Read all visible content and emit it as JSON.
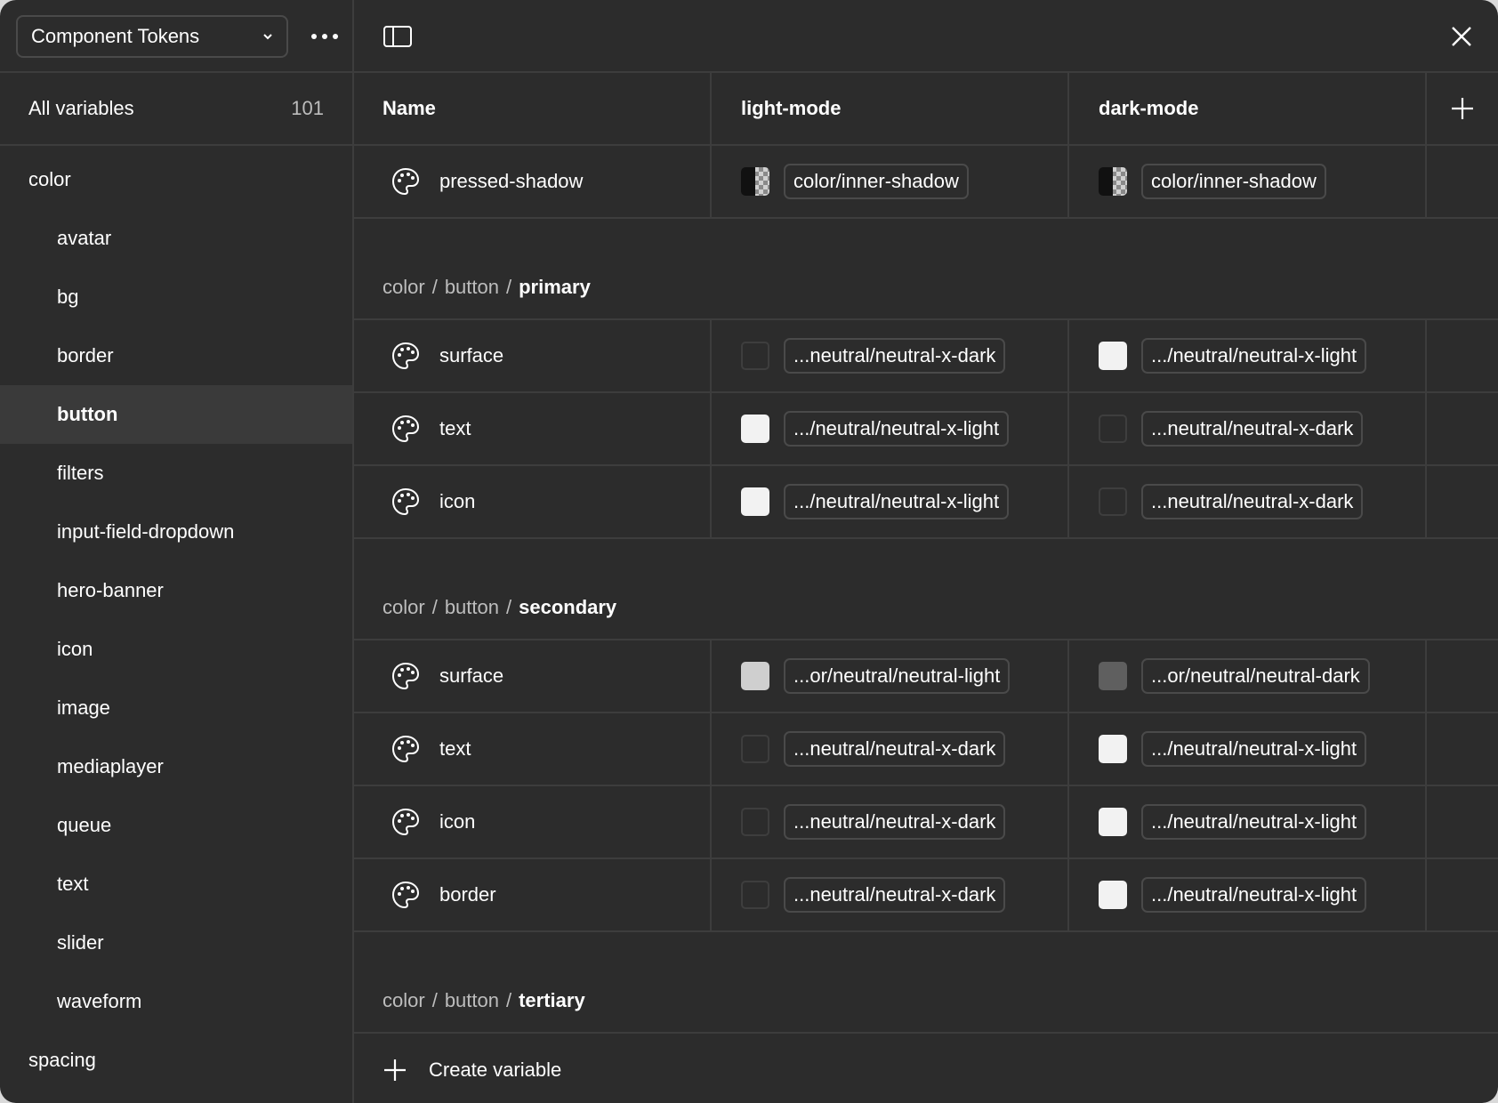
{
  "sidebar": {
    "collection": "Component Tokens",
    "all_variables": {
      "label": "All variables",
      "count": "101"
    },
    "groups": [
      {
        "label": "color",
        "level": 0
      },
      {
        "label": "avatar",
        "level": 1
      },
      {
        "label": "bg",
        "level": 1
      },
      {
        "label": "border",
        "level": 1
      },
      {
        "label": "button",
        "level": 1,
        "selected": true
      },
      {
        "label": "filters",
        "level": 1
      },
      {
        "label": "input-field-dropdown",
        "level": 1
      },
      {
        "label": "hero-banner",
        "level": 1
      },
      {
        "label": "icon",
        "level": 1
      },
      {
        "label": "image",
        "level": 1
      },
      {
        "label": "mediaplayer",
        "level": 1
      },
      {
        "label": "queue",
        "level": 1
      },
      {
        "label": "text",
        "level": 1
      },
      {
        "label": "slider",
        "level": 1
      },
      {
        "label": "waveform",
        "level": 1
      },
      {
        "label": "spacing",
        "level": 0
      }
    ]
  },
  "table": {
    "columns": {
      "name": "Name",
      "mode1": "light-mode",
      "mode2": "dark-mode"
    },
    "top_row": {
      "name": "pressed-shadow",
      "light": {
        "swatch": "shadow",
        "alias": "color/inner-shadow"
      },
      "dark": {
        "swatch": "shadow",
        "alias": "color/inner-shadow"
      }
    },
    "sections": [
      {
        "path1": "color",
        "sep": "/",
        "path2": "button",
        "sep2": "/",
        "name": "primary",
        "rows": [
          {
            "name": "surface",
            "light": {
              "swatch": "dark",
              "alias": "...neutral/neutral-x-dark"
            },
            "dark": {
              "swatch": "light",
              "alias": ".../neutral/neutral-x-light"
            }
          },
          {
            "name": "text",
            "light": {
              "swatch": "light",
              "alias": ".../neutral/neutral-x-light"
            },
            "dark": {
              "swatch": "dark",
              "alias": "...neutral/neutral-x-dark"
            }
          },
          {
            "name": "icon",
            "light": {
              "swatch": "light",
              "alias": ".../neutral/neutral-x-light"
            },
            "dark": {
              "swatch": "dark",
              "alias": "...neutral/neutral-x-dark"
            }
          }
        ]
      },
      {
        "path1": "color",
        "sep": "/",
        "path2": "button",
        "sep2": "/",
        "name": "secondary",
        "rows": [
          {
            "name": "surface",
            "light": {
              "swatch": "mid-light",
              "alias": "...or/neutral/neutral-light"
            },
            "dark": {
              "swatch": "mid-dark",
              "alias": "...or/neutral/neutral-dark"
            }
          },
          {
            "name": "text",
            "light": {
              "swatch": "dark",
              "alias": "...neutral/neutral-x-dark"
            },
            "dark": {
              "swatch": "light",
              "alias": ".../neutral/neutral-x-light"
            }
          },
          {
            "name": "icon",
            "light": {
              "swatch": "dark",
              "alias": "...neutral/neutral-x-dark"
            },
            "dark": {
              "swatch": "light",
              "alias": ".../neutral/neutral-x-light"
            }
          },
          {
            "name": "border",
            "light": {
              "swatch": "dark",
              "alias": "...neutral/neutral-x-dark"
            },
            "dark": {
              "swatch": "light",
              "alias": ".../neutral/neutral-x-light"
            }
          }
        ]
      },
      {
        "path1": "color",
        "sep": "/",
        "path2": "button",
        "sep2": "/",
        "name": "tertiary",
        "rows": []
      }
    ],
    "create_label": "Create variable"
  },
  "colors": {
    "background": "#2c2c2c",
    "divider": "#3d3d3d",
    "selected_bg": "#3a3a3a",
    "text": "#ffffff",
    "muted_text": "#bdbdbd"
  }
}
